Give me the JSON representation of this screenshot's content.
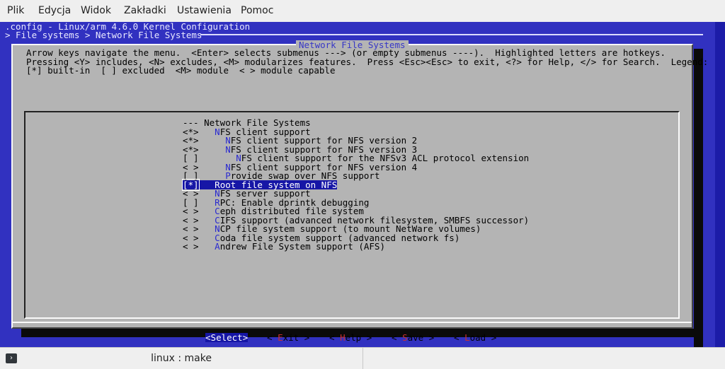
{
  "menubar": [
    "Plik",
    "Edycja",
    "Widok",
    "Zakładki",
    "Ustawienia",
    "Pomoc"
  ],
  "header": {
    "line1": ".config - Linux/arm 4.6.0 Kernel Configuration",
    "line2": "> File systems > Network File Systems"
  },
  "dialog": {
    "title": "Network File Systems",
    "intro": [
      "Arrow keys navigate the menu.  <Enter> selects submenus ---> (or empty submenus ----).  Highlighted letters are hotkeys.",
      "Pressing <Y> includes, <N> excludes, <M> modularizes features.  Press <Esc><Esc> to exit, <?> for Help, </> for Search.  Legend:",
      "[*] built-in  [ ] excluded  <M> module  < > module capable"
    ],
    "items": [
      {
        "prefix": "---",
        "indent": " ",
        "hot": "",
        "rest": "Network File Systems"
      },
      {
        "prefix": "<*>",
        "indent": "   ",
        "hot": "N",
        "rest": "FS client support"
      },
      {
        "prefix": "<*>",
        "indent": "     ",
        "hot": "N",
        "rest": "FS client support for NFS version 2"
      },
      {
        "prefix": "<*>",
        "indent": "     ",
        "hot": "N",
        "rest": "FS client support for NFS version 3"
      },
      {
        "prefix": "[ ]",
        "indent": "       ",
        "hot": "N",
        "rest": "FS client support for the NFSv3 ACL protocol extension"
      },
      {
        "prefix": "< >",
        "indent": "     ",
        "hot": "N",
        "rest": "FS client support for NFS version 4"
      },
      {
        "prefix": "[ ]",
        "indent": "     ",
        "hot": "P",
        "rest": "rovide swap over NFS support"
      },
      {
        "prefix": "[*]",
        "indent": "   ",
        "hot": "R",
        "rest": "oot file system on NFS",
        "selected": true
      },
      {
        "prefix": "< >",
        "indent": "   ",
        "hot": "N",
        "rest": "FS server support"
      },
      {
        "prefix": "[ ]",
        "indent": "   ",
        "hot": "R",
        "rest": "PC: Enable dprintk debugging"
      },
      {
        "prefix": "< >",
        "indent": "   ",
        "hot": "C",
        "rest": "eph distributed file system"
      },
      {
        "prefix": "< >",
        "indent": "   ",
        "hot": "C",
        "rest": "IFS support (advanced network filesystem, SMBFS successor)"
      },
      {
        "prefix": "< >",
        "indent": "   ",
        "hot": "N",
        "rest": "CP file system support (to mount NetWare volumes)"
      },
      {
        "prefix": "< >",
        "indent": "   ",
        "hot": "C",
        "rest": "oda file system support (advanced network fs)"
      },
      {
        "prefix": "< >",
        "indent": "   ",
        "hot": "A",
        "rest": "ndrew File System support (AFS)"
      }
    ],
    "buttons": [
      {
        "pre": "<",
        "hot": "S",
        "post": "elect>",
        "active": true
      },
      {
        "pre": "< ",
        "hot": "E",
        "post": "xit >"
      },
      {
        "pre": "< ",
        "hot": "H",
        "post": "elp >"
      },
      {
        "pre": "< ",
        "hot": "S",
        "post": "ave >"
      },
      {
        "pre": "< ",
        "hot": "L",
        "post": "oad >"
      }
    ]
  },
  "tab": {
    "title": "linux : make",
    "icon": "terminal-icon"
  },
  "colors": {
    "terminal_bg": "#3131c0",
    "dialog_bg": "#b4b4b4",
    "selection": "#1616a6",
    "hotkey": "#2a2ad0"
  }
}
